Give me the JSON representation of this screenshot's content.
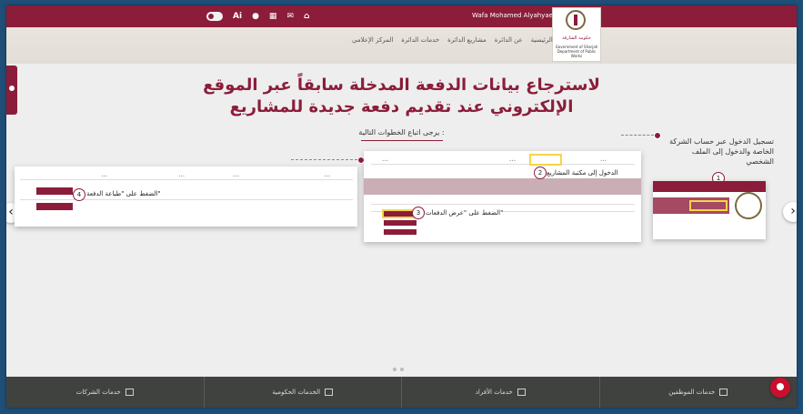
{
  "header": {
    "user_name": "Wafa Mohamed Alyahyaee",
    "toolbar_icons": [
      "toggle-switch-icon",
      "ai-icon",
      "location-icon",
      "calendar-icon",
      "mail-icon",
      "home-icon"
    ],
    "ai_label": "Ai",
    "logo": {
      "arabic": "حكومة الشارقة",
      "english_line1": "Government of Sharjah",
      "english_line2": "Department of Public Works"
    },
    "nav": [
      "الرئيسية",
      "عن الدائرة",
      "مشاريع الدائرة",
      "خدمات الدائرة",
      "المركز الإعلامي"
    ]
  },
  "hero": {
    "line1": "لاسترجاع بيانات الدفعة المدخلة سابقاً عبر الموقع",
    "line2": "الإلكتروني عند تقديم دفعة جديدة للمشاريع",
    "follow_steps": "يرجى اتباع الخطوات التالية :"
  },
  "steps": [
    {
      "number": "1",
      "text": "تسجيل الدخول عبر حساب الشركة الخاصة والدخول إلى الملف الشخصي"
    },
    {
      "number": "2",
      "text": "الدخول إلى مكتبة المشاريع"
    },
    {
      "number": "3",
      "text": "الضغط على \"عرض الدفعات\""
    },
    {
      "number": "4",
      "text": "الضغط على \"طباعة الدفعة\""
    }
  ],
  "footer": [
    {
      "label": "خدمات الموظفين",
      "icon": "employee-icon"
    },
    {
      "label": "خدمات الأفراد",
      "icon": "individuals-icon"
    },
    {
      "label": "الخدمات الحكومية",
      "icon": "government-icon"
    },
    {
      "label": "خدمات الشركات",
      "icon": "companies-icon"
    }
  ],
  "colors": {
    "brand": "#8b1d3a",
    "highlight": "#f5d44a",
    "footer_bg": "#40423f",
    "chat": "#c8102e"
  }
}
